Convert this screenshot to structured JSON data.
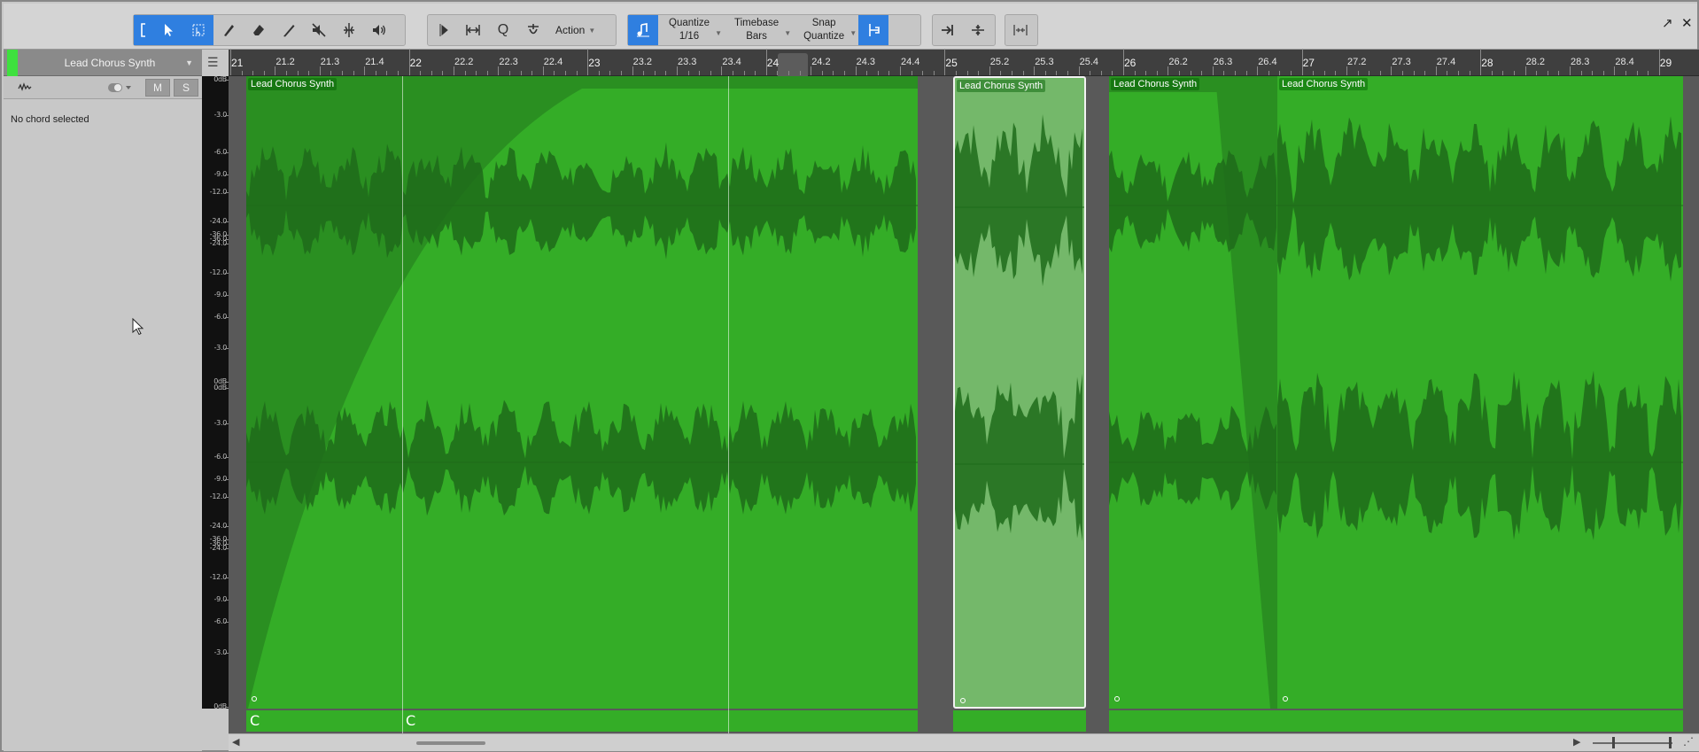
{
  "toolbar": {
    "action_label": "Action",
    "quantize": {
      "label": "Quantize",
      "value": "1/16"
    },
    "timebase": {
      "label": "Timebase",
      "value": "Bars"
    },
    "snap": {
      "label": "Snap",
      "value": "Quantize"
    },
    "accent_color": "#2f7fe0",
    "tool_icons": [
      "range-bracket-icon",
      "arrow-tool-icon",
      "range-tool-icon",
      "split-tool-icon",
      "eraser-tool-icon",
      "paint-tool-icon",
      "mute-tool-icon",
      "bend-tool-icon",
      "listen-tool-icon"
    ],
    "corner_icons": [
      "expand-icon",
      "close-icon"
    ]
  },
  "track": {
    "name": "Lead Chorus Synth",
    "color": "#3ee03e",
    "mute_label": "M",
    "solo_label": "S"
  },
  "inspector": {
    "no_chord_text": "No chord selected"
  },
  "meter_labels": [
    "0dB",
    "-3.0",
    "-6.0",
    "-9.0",
    "-12.0",
    "-24.0",
    "-36.0",
    "-36.0",
    "-24.0",
    "-12.0",
    "-9.0",
    "-6.0",
    "-3.0",
    "0dB",
    "0dB",
    "-3.0",
    "-6.0",
    "-9.0",
    "-12.0",
    "-24.0",
    "-36.0",
    "-36.0",
    "-24.0",
    "-12.0",
    "-9.0",
    "-6.0",
    "-3.0",
    "0dB"
  ],
  "ruler": {
    "labels": [
      "21",
      "21.2",
      "21.3",
      "21.4",
      "22",
      "22.2",
      "22.3",
      "22.4",
      "23",
      "23.2",
      "23.3",
      "23.4",
      "24",
      "24.2",
      "24.3",
      "24.4",
      "25",
      "25.2",
      "25.3",
      "25.4",
      "26",
      "26.2",
      "26.3",
      "26.4",
      "27",
      "27.2",
      "27.3",
      "27.4",
      "28",
      "28.2",
      "28.3",
      "28.4",
      "29"
    ],
    "major_labels": [
      "21",
      "22",
      "23",
      "24",
      "25",
      "26",
      "27",
      "28",
      "29"
    ]
  },
  "clips": [
    {
      "name": "Lead Chorus Synth",
      "selected": false
    },
    {
      "name": "Lead Chorus Synth",
      "selected": true
    },
    {
      "name": "Lead Chorus Synth",
      "selected": false
    },
    {
      "name": "Lead Chorus Synth",
      "selected": false
    }
  ],
  "chords": [
    "C",
    "C"
  ],
  "colors": {
    "clip_green": "#34ad27",
    "waveform_dark": "#1e6b1a",
    "selected_clip": "#74b86a"
  }
}
